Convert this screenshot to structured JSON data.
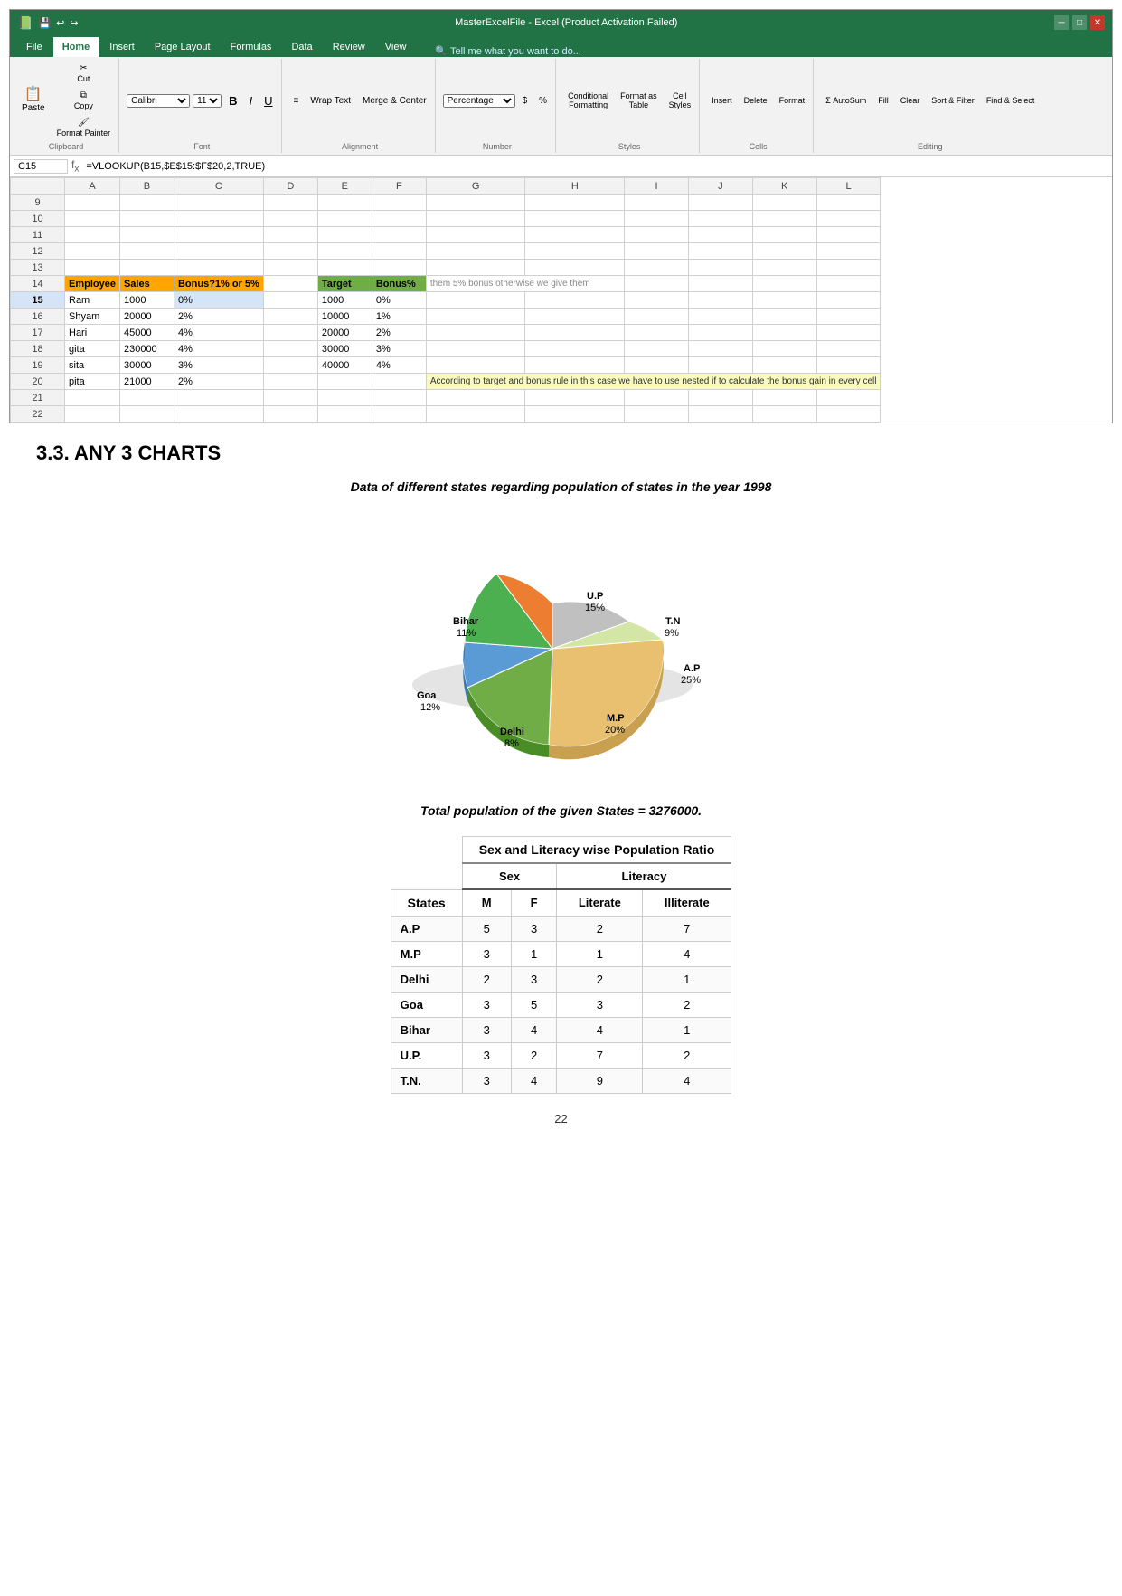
{
  "window": {
    "title": "MasterExcelFile - Excel (Product Activation Failed)",
    "quicksave": "💾",
    "undo": "↩",
    "redo": "↪"
  },
  "tabs": [
    "File",
    "Home",
    "Insert",
    "Page Layout",
    "Formulas",
    "Data",
    "Review",
    "View"
  ],
  "active_tab": "Home",
  "tell_me": "Tell me what you want to do...",
  "ribbon": {
    "groups": [
      {
        "label": "Clipboard",
        "items": [
          "Paste",
          "Cut",
          "Copy",
          "Format Painter"
        ]
      },
      {
        "label": "Font",
        "items": [
          "Calibri",
          "11",
          "B",
          "I",
          "U"
        ]
      },
      {
        "label": "Alignment",
        "items": [
          "≡",
          "Wrap Text",
          "Merge & Center"
        ]
      },
      {
        "label": "Number",
        "items": [
          "Percentage",
          "%",
          "$"
        ]
      },
      {
        "label": "Styles",
        "items": [
          "Conditional Formatting",
          "Format as Table",
          "Cell Styles"
        ]
      },
      {
        "label": "Cells",
        "items": [
          "Insert",
          "Delete",
          "Format"
        ]
      },
      {
        "label": "Editing",
        "items": [
          "AutoSum",
          "Fill",
          "Clear",
          "Sort & Filter",
          "Find & Select"
        ]
      }
    ]
  },
  "formula_bar": {
    "cell_ref": "C15",
    "formula": "=VLOOKUP(B15,$E$15:$F$20,2,TRUE)"
  },
  "spreadsheet": {
    "columns": [
      "A",
      "B",
      "C",
      "D",
      "E",
      "F",
      "G",
      "H",
      "I",
      "J",
      "K",
      "L"
    ],
    "rows": [
      {
        "num": 9,
        "cells": [
          "",
          "",
          "",
          "",
          "",
          "",
          "",
          "",
          "",
          "",
          "",
          ""
        ]
      },
      {
        "num": 10,
        "cells": [
          "",
          "",
          "",
          "",
          "",
          "",
          "",
          "",
          "",
          "",
          "",
          ""
        ]
      },
      {
        "num": 11,
        "cells": [
          "",
          "",
          "",
          "",
          "",
          "",
          "",
          "",
          "",
          "",
          "",
          ""
        ]
      },
      {
        "num": 12,
        "cells": [
          "",
          "",
          "",
          "",
          "",
          "",
          "",
          "",
          "",
          "",
          "",
          ""
        ]
      },
      {
        "num": 13,
        "cells": [
          "",
          "",
          "",
          "",
          "",
          "",
          "",
          "",
          "",
          "",
          "",
          ""
        ]
      },
      {
        "num": 14,
        "cells": [
          "Employee",
          "Sales",
          "Bonus?1% or 5%",
          "",
          "Target",
          "Bonus%",
          "",
          "",
          "",
          "",
          "",
          ""
        ],
        "header": true
      },
      {
        "num": 15,
        "cells": [
          "Ram",
          "1000",
          "0%",
          "",
          "1000",
          "0%",
          "",
          "",
          "",
          "",
          "",
          ""
        ]
      },
      {
        "num": 16,
        "cells": [
          "Shyam",
          "20000",
          "2%",
          "",
          "10000",
          "1%",
          "",
          "",
          "",
          "",
          "",
          ""
        ]
      },
      {
        "num": 17,
        "cells": [
          "Hari",
          "45000",
          "4%",
          "",
          "20000",
          "2%",
          "",
          "",
          "",
          "",
          "",
          ""
        ]
      },
      {
        "num": 18,
        "cells": [
          "gita",
          "230000",
          "4%",
          "",
          "30000",
          "3%",
          "",
          "",
          "",
          "",
          "",
          ""
        ]
      },
      {
        "num": 19,
        "cells": [
          "sita",
          "30000",
          "3%",
          "",
          "40000",
          "4%",
          "",
          "",
          "",
          "",
          "",
          ""
        ]
      },
      {
        "num": 20,
        "cells": [
          "pita",
          "21000",
          "2%",
          "",
          "",
          "",
          "",
          "",
          "",
          "",
          "",
          ""
        ],
        "note": "According to target and bonus rule in this case we have to use nested if to calculate the bonus gain in every cell"
      },
      {
        "num": 21,
        "cells": [
          "",
          "",
          "",
          "",
          "",
          "",
          "",
          "",
          "",
          "",
          "",
          ""
        ]
      },
      {
        "num": 22,
        "cells": [
          "",
          "",
          "",
          "",
          "",
          "",
          "",
          "",
          "",
          "",
          "",
          ""
        ]
      }
    ],
    "g_note": "them 5% bonus otherwise we give them"
  },
  "section": {
    "title": "3.3. ANY 3 CHARTS",
    "chart_subtitle": "Data of different states regarding population of states in the year 1998",
    "total_line": "Total population of the given States = 3276000.",
    "pie_data": [
      {
        "label": "U.P",
        "pct": 15,
        "color": "#C0C0C0",
        "angle_start": 0,
        "angle_end": 54
      },
      {
        "label": "T.N",
        "pct": 9,
        "color": "#d4e6a5",
        "angle_start": 54,
        "angle_end": 86
      },
      {
        "label": "A.P",
        "pct": 25,
        "color": "#E8C070",
        "angle_start": 86,
        "angle_end": 176
      },
      {
        "label": "M.P",
        "pct": 20,
        "color": "#A0C878",
        "angle_start": 176,
        "angle_end": 248
      },
      {
        "label": "Delhi",
        "pct": 8,
        "color": "#5B9BD5",
        "angle_start": 248,
        "angle_end": 277
      },
      {
        "label": "Goa",
        "pct": 12,
        "color": "#70AD47",
        "angle_start": 277,
        "angle_end": 320
      },
      {
        "label": "Bihar",
        "pct": 11,
        "color": "#ED7D31",
        "angle_start": 320,
        "angle_end": 360
      }
    ],
    "table": {
      "title": "Sex and Literacy wise Population Ratio",
      "headers": [
        "States",
        "Sex",
        "",
        "Literacy",
        ""
      ],
      "sub_headers": [
        "",
        "M",
        "F",
        "Literate",
        "Illiterate"
      ],
      "rows": [
        {
          "state": "A.P",
          "M": 5,
          "F": 3,
          "Literate": 2,
          "Illiterate": 7
        },
        {
          "state": "M.P",
          "M": 3,
          "F": 1,
          "Literate": 1,
          "Illiterate": 4
        },
        {
          "state": "Delhi",
          "M": 2,
          "F": 3,
          "Literate": 2,
          "Illiterate": 1
        },
        {
          "state": "Goa",
          "M": 3,
          "F": 5,
          "Literate": 3,
          "Illiterate": 2
        },
        {
          "state": "Bihar",
          "M": 3,
          "F": 4,
          "Literate": 4,
          "Illiterate": 1
        },
        {
          "state": "U.P.",
          "M": 3,
          "F": 2,
          "Literate": 7,
          "Illiterate": 2
        },
        {
          "state": "T.N.",
          "M": 3,
          "F": 4,
          "Literate": 9,
          "Illiterate": 4
        }
      ]
    }
  },
  "page_number": "22"
}
